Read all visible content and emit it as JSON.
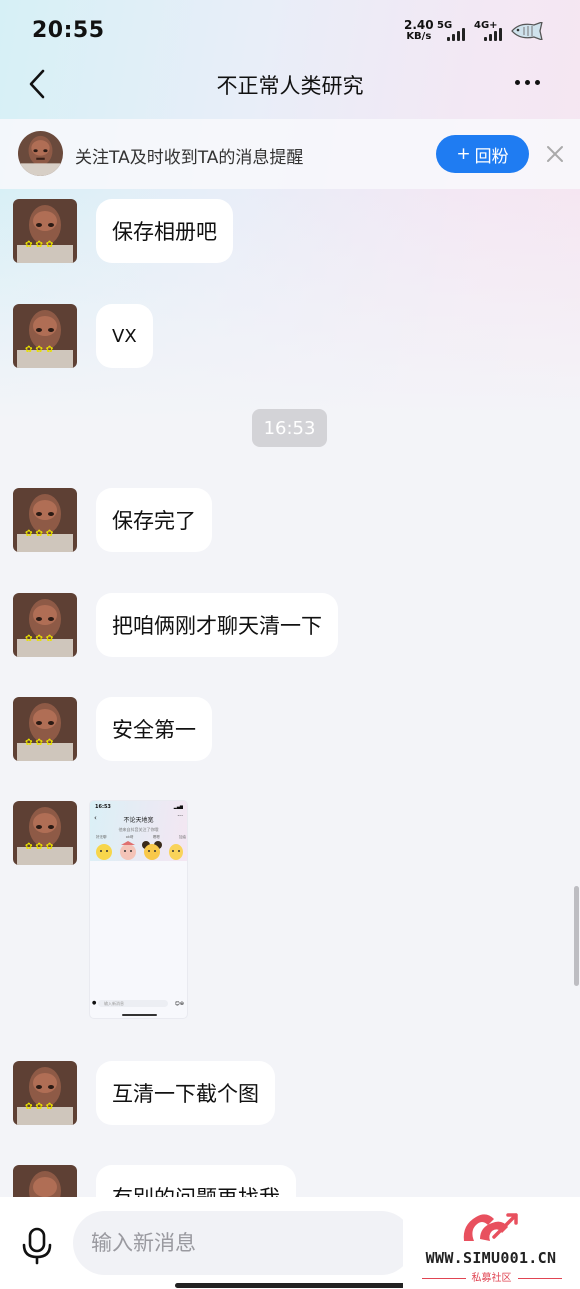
{
  "status_bar": {
    "time": "20:55",
    "net_speed_value": "2.40",
    "net_speed_unit": "KB/s",
    "signal_1": "5G",
    "signal_2": "4G+"
  },
  "nav": {
    "title": "不正常人类研究",
    "back_icon": "chevron-left-icon",
    "more_icon": "more-dots-icon"
  },
  "follow_bar": {
    "text": "关注TA及时收到TA的消息提醒",
    "button_label": "回粉",
    "button_color": "#1f7cf2"
  },
  "messages": [
    {
      "type": "text",
      "text": "保存相册吧"
    },
    {
      "type": "text",
      "text": "VX"
    },
    {
      "type": "time",
      "text": "16:53"
    },
    {
      "type": "text",
      "text": "保存完了"
    },
    {
      "type": "text",
      "text": "把咱俩刚才聊天清一下"
    },
    {
      "type": "text",
      "text": "安全第一"
    },
    {
      "type": "image",
      "text": ""
    },
    {
      "type": "text",
      "text": "互清一下截个图"
    },
    {
      "type": "text",
      "text": "有别的问题再找我"
    }
  ],
  "thumbnail": {
    "time": "16:53",
    "title": "不论天地宽",
    "tip": "他来自抖音关注了你哦",
    "sticker_labels": [
      "好无聊",
      "ok呀",
      "嗯嗯",
      "加油"
    ],
    "input_placeholder": "输入新消息"
  },
  "input": {
    "placeholder": "输入新消息"
  },
  "watermark": {
    "site": "WWW.SIMU001.CN",
    "sub": "私募社区"
  }
}
